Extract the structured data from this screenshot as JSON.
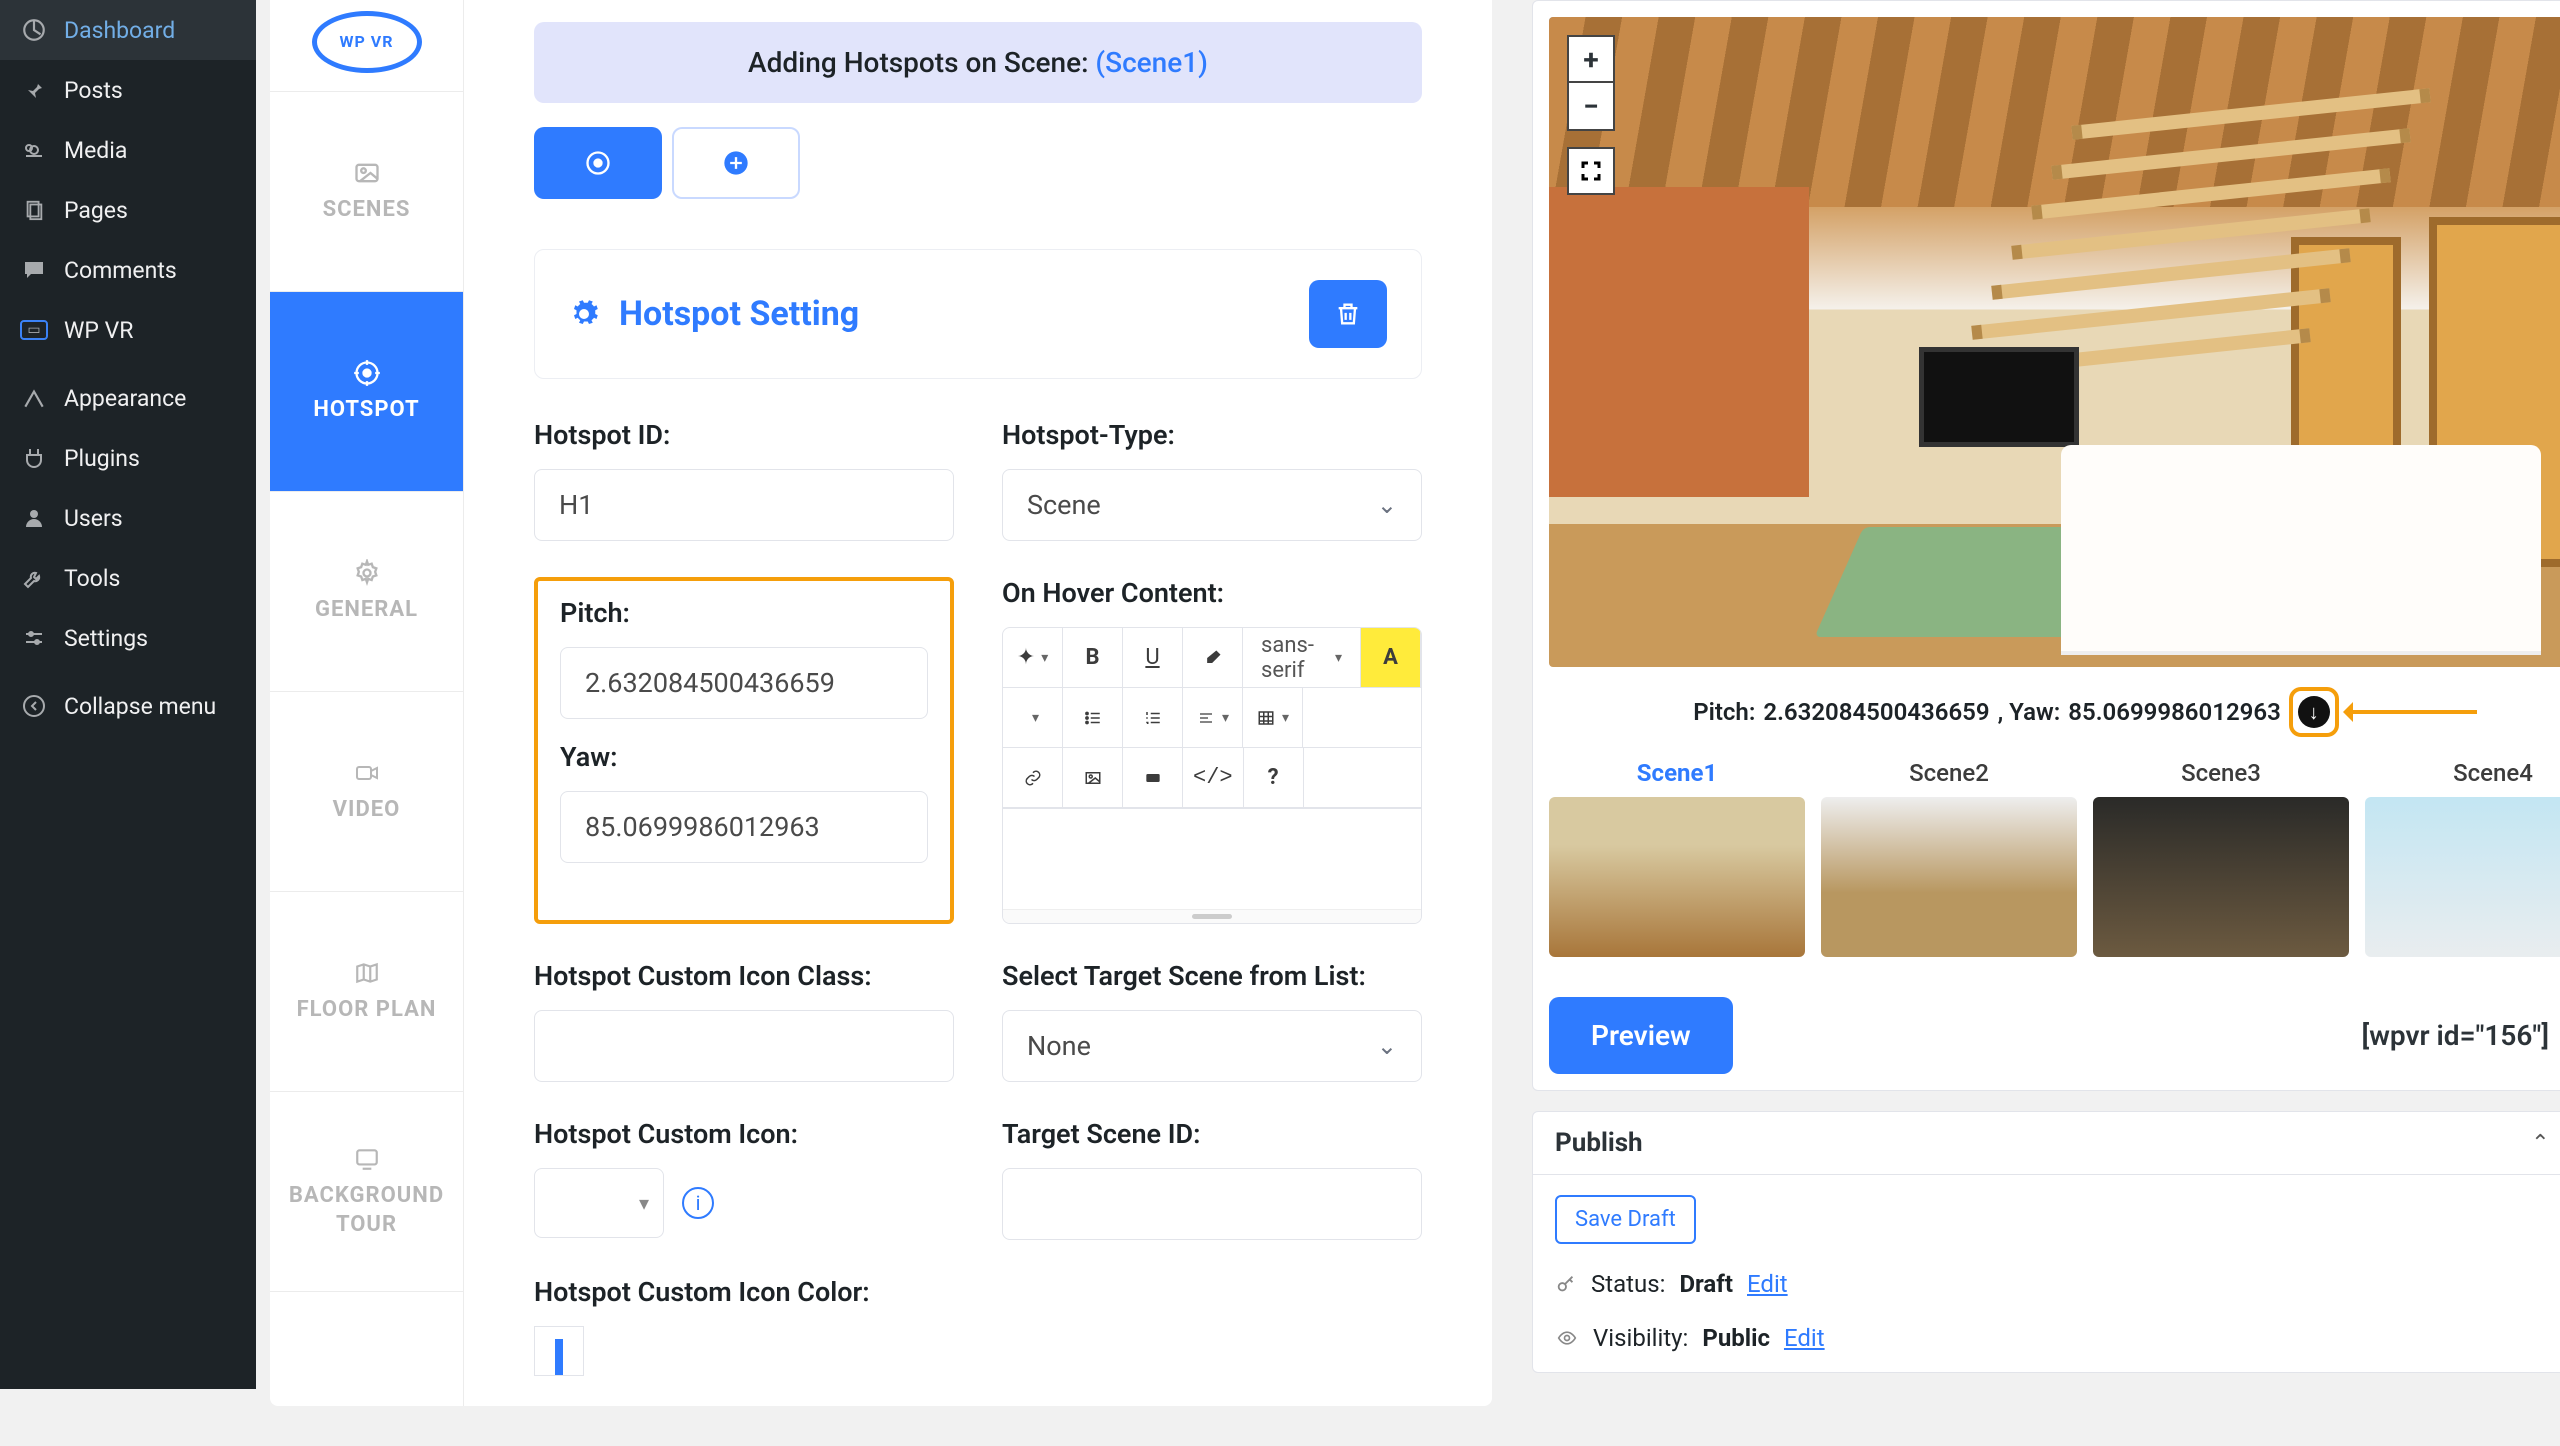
{
  "wp_sidebar": [
    {
      "icon": "dashboard",
      "label": "Dashboard"
    },
    {
      "icon": "pin",
      "label": "Posts"
    },
    {
      "icon": "media",
      "label": "Media"
    },
    {
      "icon": "pages",
      "label": "Pages"
    },
    {
      "icon": "comment",
      "label": "Comments"
    },
    {
      "icon": "wpvr",
      "label": "WP VR"
    },
    {
      "icon": "appearance",
      "label": "Appearance",
      "sep": true
    },
    {
      "icon": "plugin",
      "label": "Plugins"
    },
    {
      "icon": "user",
      "label": "Users"
    },
    {
      "icon": "tools",
      "label": "Tools"
    },
    {
      "icon": "settings",
      "label": "Settings"
    },
    {
      "icon": "collapse",
      "label": "Collapse menu",
      "sep": true
    }
  ],
  "vtabs": [
    {
      "key": "scenes",
      "label": "SCENES"
    },
    {
      "key": "hotspot",
      "label": "HOTSPOT",
      "active": true
    },
    {
      "key": "general",
      "label": "GENERAL"
    },
    {
      "key": "video",
      "label": "VIDEO"
    },
    {
      "key": "floorplan",
      "label": "FLOOR PLAN"
    },
    {
      "key": "bgtour",
      "label": "BACKGROUND TOUR"
    }
  ],
  "banner_prefix": "Adding Hotspots on Scene: ",
  "banner_scene": "(Scene1)",
  "section_title": "Hotspot Setting",
  "fields": {
    "hotspot_id": {
      "label": "Hotspot ID:",
      "value": "H1"
    },
    "hotspot_type": {
      "label": "Hotspot-Type:",
      "value": "Scene"
    },
    "pitch": {
      "label": "Pitch:",
      "value": "2.632084500436659"
    },
    "yaw": {
      "label": "Yaw:",
      "value": "85.0699986012963"
    },
    "on_hover": {
      "label": "On Hover Content:"
    },
    "icon_class": {
      "label": "Hotspot Custom Icon Class:",
      "value": ""
    },
    "custom_icon": {
      "label": "Hotspot Custom Icon:"
    },
    "icon_color": {
      "label": "Hotspot Custom Icon Color:"
    },
    "target_scene": {
      "label": "Select Target Scene from List:",
      "value": "None"
    },
    "target_scene_id": {
      "label": "Target Scene ID:"
    }
  },
  "rte_font": "sans-serif",
  "preview": {
    "pitch_label": "Pitch: ",
    "pitch_value": "2.632084500436659",
    "yaw_label": ", Yaw: ",
    "yaw_value": "85.0699986012963"
  },
  "thumbs": [
    {
      "name": "Scene1",
      "active": true,
      "bg": "linear-gradient(#d8c9a0 30%,#a8763a)"
    },
    {
      "name": "Scene2",
      "bg": "linear-gradient(#eee 0%,#b89760 60%)"
    },
    {
      "name": "Scene3",
      "bg": "linear-gradient(#2a2a28 0%,#6c5a40)"
    },
    {
      "name": "Scene4",
      "bg": "linear-gradient(#c3e6f3 0%,#e9edef)"
    }
  ],
  "preview_btn": "Preview",
  "shortcode": "[wpvr id=\"156\"]",
  "publish": {
    "title": "Publish",
    "save_draft": "Save Draft",
    "status_label": "Status: ",
    "status_value": "Draft",
    "visibility_label": "Visibility: ",
    "visibility_value": "Public",
    "edit": "Edit"
  }
}
